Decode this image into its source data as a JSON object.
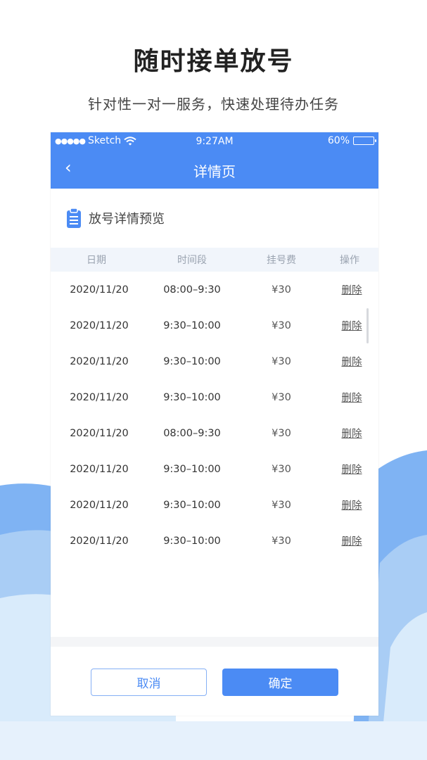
{
  "promo": {
    "headline": "随时接单放号",
    "subline": "针对性一对一服务，快速处理待办任务"
  },
  "status_bar": {
    "carrier": "Sketch",
    "time": "9:27AM",
    "battery": "60%",
    "battery_level": 0.6
  },
  "nav": {
    "back_icon": "‹",
    "title": "详情页"
  },
  "section": {
    "icon": "clipboard-icon",
    "title": "放号详情预览"
  },
  "table": {
    "headers": [
      "日期",
      "时间段",
      "挂号费",
      "操作"
    ],
    "rows": [
      {
        "date": "2020/11/20",
        "time": "08:00–9:30",
        "fee": "¥30",
        "op": "删除"
      },
      {
        "date": "2020/11/20",
        "time": "9:30–10:00",
        "fee": "¥30",
        "op": "删除"
      },
      {
        "date": "2020/11/20",
        "time": "9:30–10:00",
        "fee": "¥30",
        "op": "删除"
      },
      {
        "date": "2020/11/20",
        "time": "9:30–10:00",
        "fee": "¥30",
        "op": "删除"
      },
      {
        "date": "2020/11/20",
        "time": "08:00–9:30",
        "fee": "¥30",
        "op": "删除"
      },
      {
        "date": "2020/11/20",
        "time": "9:30–10:00",
        "fee": "¥30",
        "op": "删除"
      },
      {
        "date": "2020/11/20",
        "time": "9:30–10:00",
        "fee": "¥30",
        "op": "删除"
      },
      {
        "date": "2020/11/20",
        "time": "9:30–10:00",
        "fee": "¥30",
        "op": "删除"
      }
    ]
  },
  "footer": {
    "cancel_label": "取消",
    "confirm_label": "确定"
  },
  "colors": {
    "accent": "#4b8bf4",
    "cloud_back": "#a9cdf5",
    "cloud_front": "#d9ebfb"
  }
}
